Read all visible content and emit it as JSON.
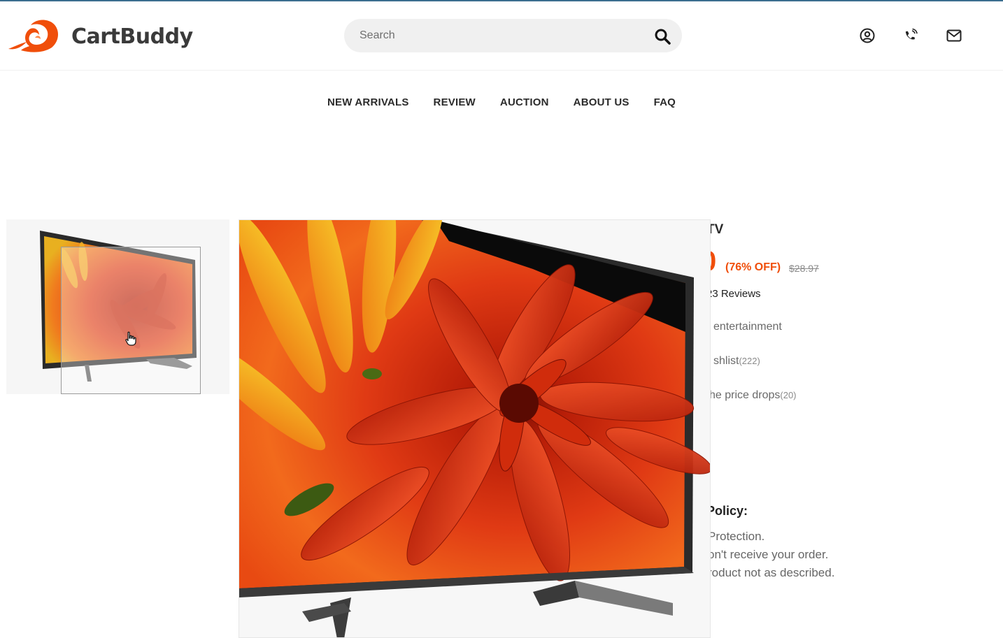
{
  "brand": {
    "name": "CartBuddy",
    "logo_icon": "swirl-logo",
    "accent_color": "#f04e0a"
  },
  "search": {
    "placeholder": "Search",
    "icon": "search-icon"
  },
  "header_icons": [
    "user-circle-icon",
    "phone-icon",
    "mail-icon"
  ],
  "nav": {
    "items": [
      {
        "label": "NEW ARRIVALS"
      },
      {
        "label": "REVIEW"
      },
      {
        "label": "AUCTION"
      },
      {
        "label": "ABOUT US"
      },
      {
        "label": "FAQ"
      }
    ]
  },
  "product": {
    "title_partial": "TV",
    "price_partial": "0",
    "discount": "(76% OFF)",
    "original_price": "$28.97",
    "reviews": "23 Reviews",
    "feature": "entertainment",
    "wishlist_label": "shlist",
    "wishlist_count": "(222)",
    "price_drop_label": "he price drops",
    "price_drop_count": "(20)",
    "policy_heading": "Policy:",
    "policy_lines": [
      "Protection.",
      "on't receive your order.",
      "roduct not as described."
    ]
  }
}
